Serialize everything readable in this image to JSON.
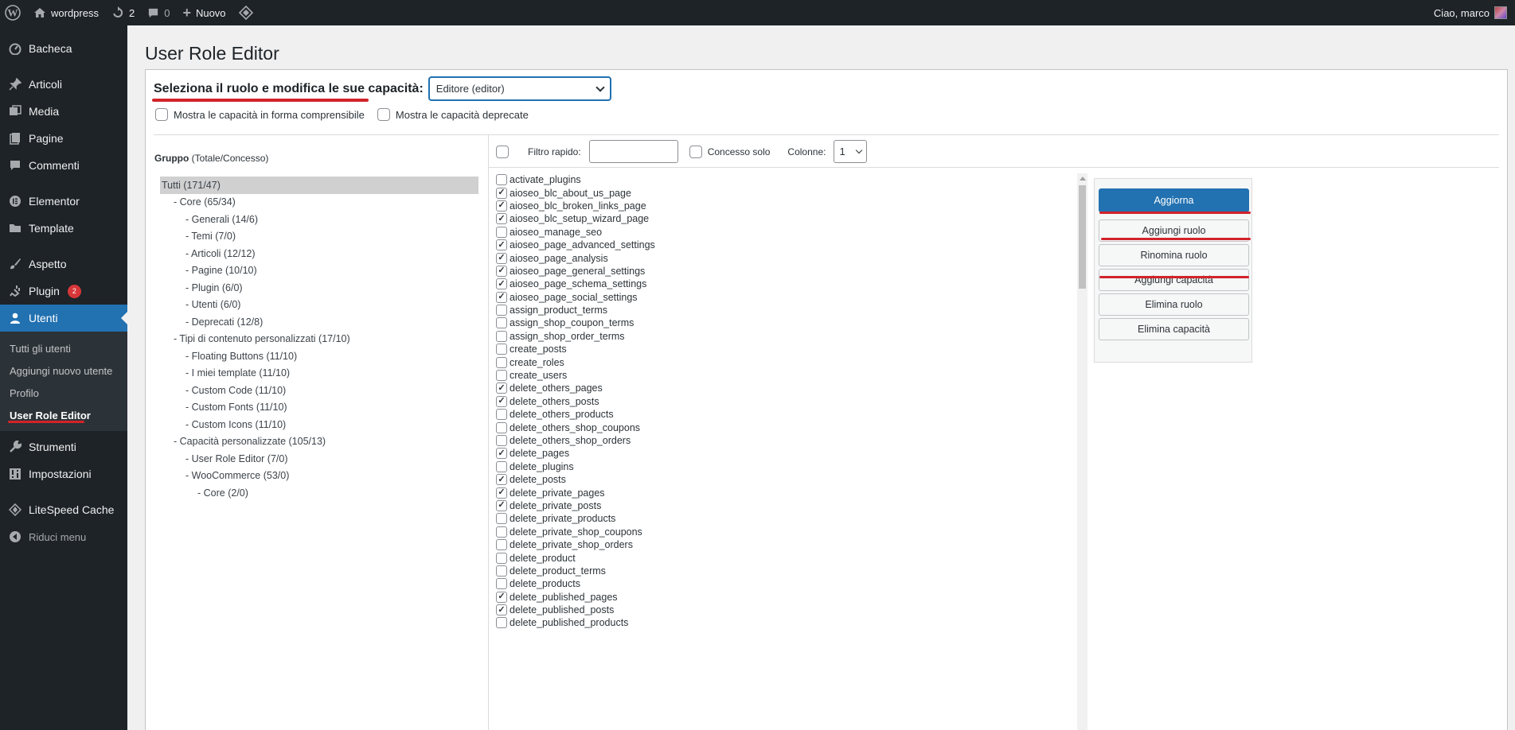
{
  "adminbar": {
    "site_name": "wordpress",
    "updates_count": "2",
    "comments_count": "0",
    "new_label": "Nuovo",
    "greeting": "Ciao, marco"
  },
  "sidebar": {
    "items": [
      {
        "label": "Bacheca",
        "icon": "dashboard-icon"
      },
      {
        "label": "Articoli",
        "icon": "pin-icon"
      },
      {
        "label": "Media",
        "icon": "media-icon"
      },
      {
        "label": "Pagine",
        "icon": "page-icon"
      },
      {
        "label": "Commenti",
        "icon": "comment-icon"
      },
      {
        "label": "Elementor",
        "icon": "elementor-icon"
      },
      {
        "label": "Template",
        "icon": "folder-icon"
      },
      {
        "label": "Aspetto",
        "icon": "brush-icon"
      },
      {
        "label": "Plugin",
        "icon": "plugin-icon",
        "badge": "2"
      },
      {
        "label": "Utenti",
        "icon": "user-icon"
      },
      {
        "label": "Strumenti",
        "icon": "wrench-icon"
      },
      {
        "label": "Impostazioni",
        "icon": "settings-icon"
      },
      {
        "label": "LiteSpeed Cache",
        "icon": "litespeed-icon"
      },
      {
        "label": "Riduci menu",
        "icon": "collapse-icon"
      }
    ],
    "submenu": [
      "Tutti gli utenti",
      "Aggiungi nuovo utente",
      "Profilo",
      "User Role Editor"
    ]
  },
  "page": {
    "title": "User Role Editor",
    "role_label": "Seleziona il ruolo e modifica le sue capacità:",
    "role_selected": "Editore (editor)",
    "opt_readable": "Mostra le capacità in forma comprensibile",
    "opt_deprecated": "Mostra le capacità deprecate",
    "group_head_bold": "Gruppo",
    "group_head_rest": "(Totale/Concesso)",
    "filter_label": "Filtro rapido:",
    "granted_only": "Concesso solo",
    "columns_label": "Colonne:",
    "columns_value": "1"
  },
  "tree": [
    {
      "label": "Tutti (171/47)",
      "level": 0,
      "selected": true
    },
    {
      "label": "- Core (65/34)",
      "level": 1
    },
    {
      "label": "- Generali (14/6)",
      "level": 2
    },
    {
      "label": "- Temi (7/0)",
      "level": 2
    },
    {
      "label": "- Articoli (12/12)",
      "level": 2
    },
    {
      "label": "- Pagine (10/10)",
      "level": 2
    },
    {
      "label": "- Plugin (6/0)",
      "level": 2
    },
    {
      "label": "- Utenti (6/0)",
      "level": 2
    },
    {
      "label": "- Deprecati (12/8)",
      "level": 2
    },
    {
      "label": "- Tipi di contenuto personalizzati (17/10)",
      "level": 1
    },
    {
      "label": "- Floating Buttons (11/10)",
      "level": 2
    },
    {
      "label": "- I miei template (11/10)",
      "level": 2
    },
    {
      "label": "- Custom Code (11/10)",
      "level": 2
    },
    {
      "label": "- Custom Fonts (11/10)",
      "level": 2
    },
    {
      "label": "- Custom Icons (11/10)",
      "level": 2
    },
    {
      "label": "- Capacità personalizzate (105/13)",
      "level": 1
    },
    {
      "label": "- User Role Editor (7/0)",
      "level": 2
    },
    {
      "label": "- WooCommerce (53/0)",
      "level": 2
    },
    {
      "label": "- Core (2/0)",
      "level": 3
    }
  ],
  "capabilities": [
    {
      "name": "activate_plugins",
      "checked": false
    },
    {
      "name": "aioseo_blc_about_us_page",
      "checked": true
    },
    {
      "name": "aioseo_blc_broken_links_page",
      "checked": true
    },
    {
      "name": "aioseo_blc_setup_wizard_page",
      "checked": true
    },
    {
      "name": "aioseo_manage_seo",
      "checked": false
    },
    {
      "name": "aioseo_page_advanced_settings",
      "checked": true
    },
    {
      "name": "aioseo_page_analysis",
      "checked": true
    },
    {
      "name": "aioseo_page_general_settings",
      "checked": true
    },
    {
      "name": "aioseo_page_schema_settings",
      "checked": true
    },
    {
      "name": "aioseo_page_social_settings",
      "checked": true
    },
    {
      "name": "assign_product_terms",
      "checked": false
    },
    {
      "name": "assign_shop_coupon_terms",
      "checked": false
    },
    {
      "name": "assign_shop_order_terms",
      "checked": false
    },
    {
      "name": "create_posts",
      "checked": false
    },
    {
      "name": "create_roles",
      "checked": false
    },
    {
      "name": "create_users",
      "checked": false
    },
    {
      "name": "delete_others_pages",
      "checked": true
    },
    {
      "name": "delete_others_posts",
      "checked": true
    },
    {
      "name": "delete_others_products",
      "checked": false
    },
    {
      "name": "delete_others_shop_coupons",
      "checked": false
    },
    {
      "name": "delete_others_shop_orders",
      "checked": false
    },
    {
      "name": "delete_pages",
      "checked": true
    },
    {
      "name": "delete_plugins",
      "checked": false
    },
    {
      "name": "delete_posts",
      "checked": true
    },
    {
      "name": "delete_private_pages",
      "checked": true
    },
    {
      "name": "delete_private_posts",
      "checked": true
    },
    {
      "name": "delete_private_products",
      "checked": false
    },
    {
      "name": "delete_private_shop_coupons",
      "checked": false
    },
    {
      "name": "delete_private_shop_orders",
      "checked": false
    },
    {
      "name": "delete_product",
      "checked": false
    },
    {
      "name": "delete_product_terms",
      "checked": false
    },
    {
      "name": "delete_products",
      "checked": false
    },
    {
      "name": "delete_published_pages",
      "checked": true
    },
    {
      "name": "delete_published_posts",
      "checked": true
    },
    {
      "name": "delete_published_products",
      "checked": false
    }
  ],
  "buttons": {
    "update": "Aggiorna",
    "add_role": "Aggiungi ruolo",
    "rename_role": "Rinomina ruolo",
    "add_cap": "Aggiungi capacità",
    "delete_role": "Elimina ruolo",
    "delete_cap": "Elimina capacità"
  },
  "colors": {
    "primary": "#2271b1",
    "annotation_red": "#d2232a"
  }
}
